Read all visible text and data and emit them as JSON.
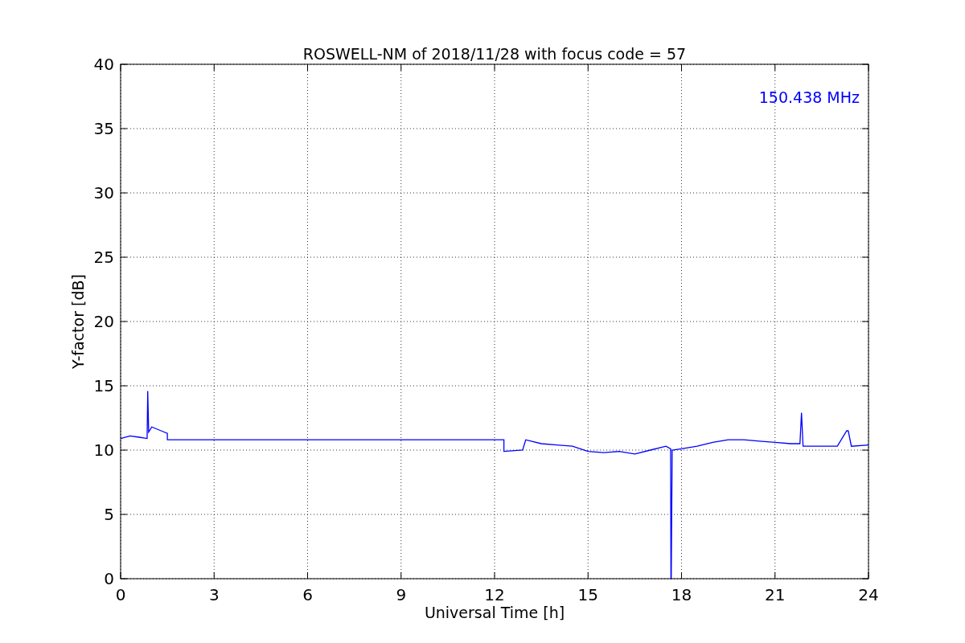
{
  "chart_data": {
    "type": "line",
    "title": "ROSWELL-NM of 2018/11/28 with focus code = 57",
    "xlabel": "Universal Time [h]",
    "ylabel": "Y-factor [dB]",
    "xlim": [
      0,
      24
    ],
    "ylim": [
      0,
      40
    ],
    "xticks": [
      0,
      3,
      6,
      9,
      12,
      15,
      18,
      21,
      24
    ],
    "yticks": [
      0,
      5,
      10,
      15,
      20,
      25,
      30,
      35,
      40
    ],
    "grid": true,
    "series": [
      {
        "color": "#0000ff",
        "x": [
          0,
          0.3,
          0.6,
          0.85,
          0.87,
          0.9,
          1.0,
          1.3,
          1.5,
          1.5,
          12.3,
          12.3,
          12.9,
          13.0,
          13.5,
          14.0,
          14.5,
          15.0,
          15.5,
          16.0,
          16.5,
          17.0,
          17.5,
          17.65,
          17.66,
          17.67,
          17.7,
          18.0,
          18.5,
          19.0,
          19.5,
          20.0,
          20.5,
          21.0,
          21.5,
          21.8,
          21.85,
          21.9,
          22.5,
          23.0,
          23.3,
          23.35,
          23.45,
          24.0
        ],
        "values": [
          10.9,
          11.1,
          11.0,
          10.9,
          14.6,
          11.4,
          11.8,
          11.5,
          11.3,
          10.8,
          10.8,
          9.9,
          10.0,
          10.8,
          10.5,
          10.4,
          10.3,
          9.9,
          9.8,
          9.9,
          9.7,
          10.0,
          10.3,
          10.1,
          0,
          0,
          10.0,
          10.1,
          10.3,
          10.6,
          10.8,
          10.8,
          10.7,
          10.6,
          10.5,
          10.5,
          12.9,
          10.3,
          10.3,
          10.3,
          11.5,
          11.5,
          10.3,
          10.4
        ]
      }
    ],
    "annotations": [
      "150.438 MHz"
    ]
  }
}
